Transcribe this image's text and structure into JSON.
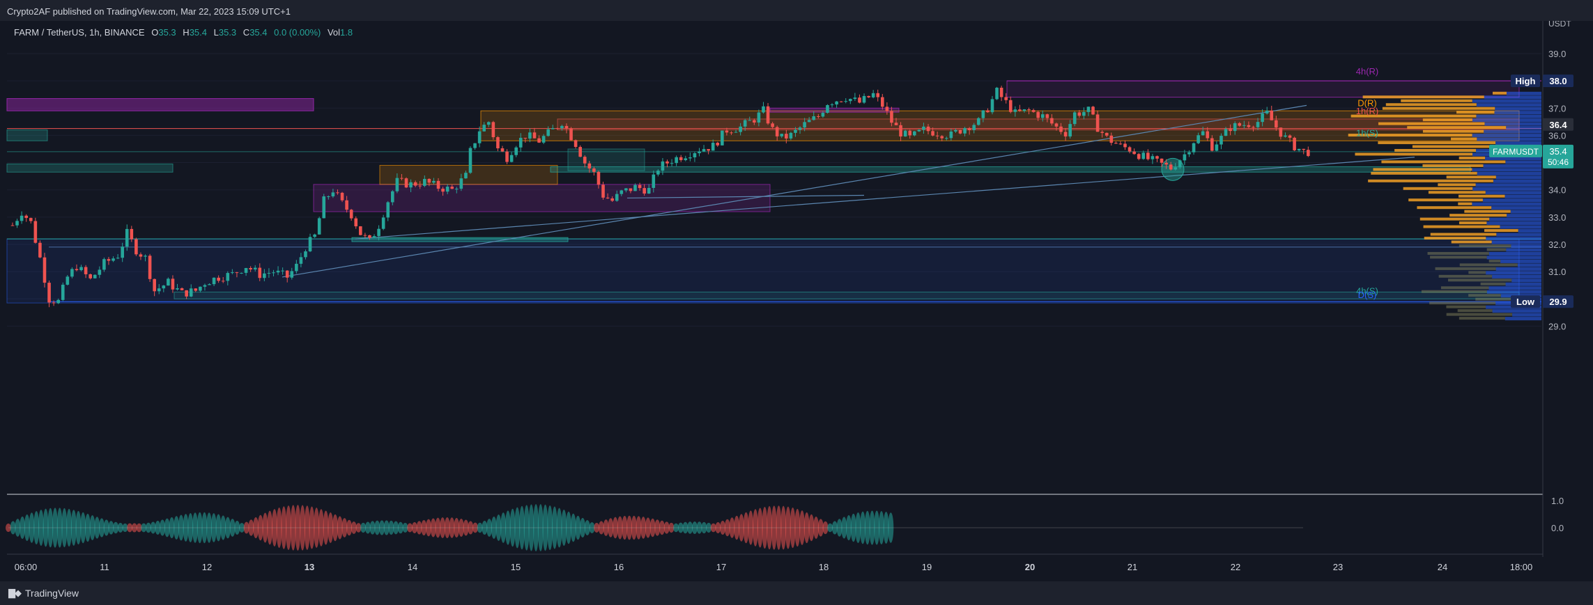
{
  "header": {
    "published": "Crypto2AF published on TradingView.com, Mar 22, 2023 15:09 UTC+1"
  },
  "legend": {
    "symbol": "FARM / TetherUS, 1h, BINANCE",
    "o_label": "O",
    "o": "35.3",
    "h_label": "H",
    "h": "35.4",
    "l_label": "L",
    "l": "35.3",
    "c_label": "C",
    "c": "35.4",
    "change": "0.0 (0.00%)",
    "vol_label": "Vol",
    "vol": "1.8"
  },
  "footer": {
    "brand": "TradingView"
  },
  "colors": {
    "background": "#131722",
    "bull": "#26a69a",
    "bear": "#ef5350",
    "accent_blue": "#2962ff",
    "zone_purple": "#9c27b0",
    "zone_orange": "#ff9800",
    "zone_green": "#00e676"
  },
  "chart_data": {
    "type": "candlestick",
    "symbol": "FARMUSDT",
    "currency_label": "USDT",
    "y_ticks": [
      "29.0",
      "30.0",
      "31.0",
      "32.0",
      "33.0",
      "34.0",
      "35.0",
      "36.0",
      "37.0",
      "38.0",
      "39.0"
    ],
    "ylim": [
      28.5,
      40.2
    ],
    "x_ticks": [
      "06:00",
      "11",
      "12",
      "13",
      "14",
      "15",
      "16",
      "17",
      "18",
      "19",
      "20",
      "21",
      "22",
      "23",
      "24",
      "18:00"
    ],
    "bold_x_ticks": [
      "13",
      "20"
    ],
    "last_price": "35.4",
    "countdown": "50:46",
    "high_label": "High",
    "high_value": "38.0",
    "low_label": "Low",
    "low_value": "29.9",
    "level_value": "36.4",
    "zone_labels": [
      {
        "text": "4h(R)",
        "price": 38.15,
        "color": "#9c27b0"
      },
      {
        "text": "D(R)",
        "price": 37.0,
        "color": "#ff9800"
      },
      {
        "text": "1h(R)",
        "price": 36.7,
        "color": "#ef5350"
      },
      {
        "text": "1h(S)",
        "price": 35.9,
        "color": "#26a69a"
      },
      {
        "text": "4h(S)",
        "price": 30.1,
        "color": "#26a69a"
      },
      {
        "text": "D(S)",
        "price": 29.95,
        "color": "#2962ff"
      }
    ],
    "path_points": [
      [
        0,
        32.7
      ],
      [
        2,
        33.2
      ],
      [
        4,
        32.8
      ],
      [
        6,
        31.5
      ],
      [
        8,
        30.0
      ],
      [
        10,
        29.9
      ],
      [
        12,
        30.8
      ],
      [
        14,
        31.2
      ],
      [
        17,
        30.7
      ],
      [
        20,
        31.3
      ],
      [
        23,
        31.6
      ],
      [
        25,
        32.4
      ],
      [
        27,
        31.8
      ],
      [
        29,
        31.5
      ],
      [
        31,
        30.3
      ],
      [
        34,
        30.6
      ],
      [
        37,
        30.2
      ],
      [
        40,
        30.3
      ],
      [
        42,
        30.6
      ],
      [
        45,
        30.8
      ],
      [
        48,
        30.9
      ],
      [
        51,
        31.2
      ],
      [
        54,
        30.9
      ],
      [
        57,
        31.0
      ],
      [
        60,
        30.8
      ],
      [
        62,
        31.2
      ],
      [
        64,
        31.9
      ],
      [
        66,
        32.3
      ],
      [
        68,
        33.6
      ],
      [
        70,
        34.0
      ],
      [
        72,
        33.5
      ],
      [
        74,
        33.1
      ],
      [
        76,
        32.4
      ],
      [
        78,
        32.1
      ],
      [
        80,
        32.7
      ],
      [
        82,
        33.6
      ],
      [
        84,
        34.3
      ],
      [
        87,
        34.2
      ],
      [
        90,
        34.3
      ],
      [
        93,
        34.1
      ],
      [
        96,
        34.0
      ],
      [
        99,
        34.5
      ],
      [
        100,
        35.4
      ],
      [
        102,
        36.2
      ],
      [
        104,
        36.5
      ],
      [
        106,
        35.5
      ],
      [
        108,
        35.2
      ],
      [
        110,
        35.7
      ],
      [
        112,
        36.0
      ],
      [
        115,
        35.8
      ],
      [
        118,
        36.2
      ],
      [
        120,
        36.5
      ],
      [
        123,
        35.7
      ],
      [
        125,
        35.0
      ],
      [
        127,
        34.6
      ],
      [
        129,
        33.8
      ],
      [
        131,
        33.6
      ],
      [
        133,
        33.9
      ],
      [
        136,
        34.1
      ],
      [
        139,
        34.0
      ],
      [
        141,
        34.8
      ],
      [
        144,
        35.1
      ],
      [
        147,
        35.3
      ],
      [
        150,
        35.5
      ],
      [
        153,
        35.6
      ],
      [
        156,
        36.2
      ],
      [
        159,
        36.3
      ],
      [
        162,
        36.6
      ],
      [
        164,
        36.9
      ],
      [
        166,
        36.2
      ],
      [
        168,
        35.9
      ],
      [
        170,
        36.0
      ],
      [
        173,
        36.4
      ],
      [
        176,
        36.7
      ],
      [
        178,
        37.2
      ],
      [
        180,
        37.3
      ],
      [
        182,
        37.4
      ],
      [
        185,
        37.2
      ],
      [
        188,
        37.5
      ],
      [
        190,
        37.1
      ],
      [
        192,
        36.5
      ],
      [
        194,
        36.1
      ],
      [
        196,
        35.9
      ],
      [
        199,
        36.2
      ],
      [
        202,
        36.1
      ],
      [
        205,
        36.0
      ],
      [
        208,
        36.3
      ],
      [
        211,
        36.5
      ],
      [
        213,
        37.0
      ],
      [
        215,
        37.6
      ],
      [
        217,
        37.2
      ],
      [
        219,
        36.8
      ],
      [
        222,
        36.9
      ],
      [
        225,
        36.7
      ],
      [
        228,
        36.3
      ],
      [
        230,
        36.1
      ],
      [
        232,
        36.8
      ],
      [
        235,
        36.9
      ],
      [
        237,
        36.3
      ],
      [
        239,
        35.9
      ],
      [
        242,
        35.6
      ],
      [
        244,
        35.5
      ],
      [
        247,
        35.2
      ],
      [
        250,
        35.0
      ],
      [
        253,
        34.8
      ],
      [
        256,
        35.3
      ],
      [
        258,
        35.8
      ],
      [
        260,
        36.1
      ],
      [
        262,
        35.6
      ],
      [
        264,
        35.9
      ],
      [
        266,
        36.3
      ],
      [
        269,
        36.4
      ],
      [
        272,
        36.5
      ],
      [
        274,
        36.8
      ],
      [
        276,
        36.3
      ],
      [
        278,
        35.9
      ],
      [
        280,
        35.6
      ],
      [
        282,
        35.4
      ],
      [
        284,
        35.4
      ]
    ]
  }
}
